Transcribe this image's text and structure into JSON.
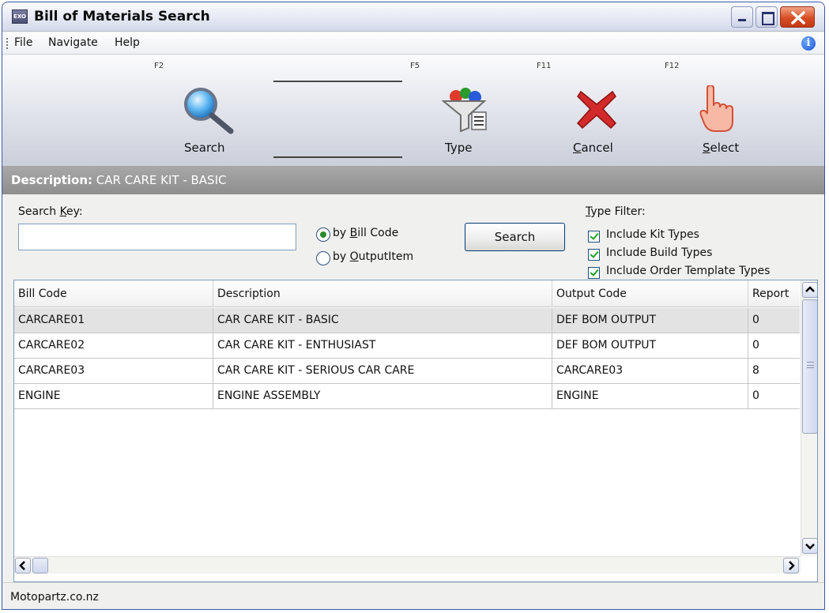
{
  "window": {
    "title": "Bill of Materials Search",
    "app_icon_text": "EXO"
  },
  "menu": {
    "items": [
      "File",
      "Navigate",
      "Help"
    ]
  },
  "toolbar": {
    "search": {
      "key": "F2",
      "label": "Search"
    },
    "type": {
      "key": "F5",
      "label": "Type"
    },
    "cancel": {
      "key": "F11",
      "label": "Cancel"
    },
    "select": {
      "key": "F12",
      "label": "Select"
    }
  },
  "description_bar": {
    "label": "Description:",
    "value": "CAR CARE KIT - BASIC"
  },
  "search": {
    "key_label": "Search Key:",
    "value": "",
    "radio_bill_code": "by Bill Code",
    "radio_output_item": "by OutputItem",
    "selected": "by Bill Code",
    "button": "Search"
  },
  "type_filter": {
    "label": "Type Filter:",
    "options": [
      {
        "label": "Include Kit Types",
        "checked": true
      },
      {
        "label": "Include Build Types",
        "checked": true
      },
      {
        "label": "Include Order Template Types",
        "checked": true
      }
    ]
  },
  "grid": {
    "columns": [
      "Bill Code",
      "Description",
      "Output Code",
      "Report"
    ],
    "rows": [
      [
        "CARCARE01",
        "CAR CARE KIT - BASIC",
        "DEF BOM OUTPUT",
        "0"
      ],
      [
        "CARCARE02",
        "CAR CARE KIT - ENTHUSIAST",
        "DEF BOM OUTPUT",
        "0"
      ],
      [
        "CARCARE03",
        "CAR CARE KIT - SERIOUS CAR CARE",
        "CARCARE03",
        "8"
      ],
      [
        "ENGINE",
        "ENGINE ASSEMBLY",
        "ENGINE",
        "0"
      ]
    ],
    "selected_row": 0
  },
  "status": {
    "text": "Motopartz.co.nz"
  },
  "colors": {
    "title_bar": "#e9ecf6",
    "description_bar": "#9b9b9b",
    "close_button": "#d74d24",
    "selection": "#e3e3e3"
  }
}
